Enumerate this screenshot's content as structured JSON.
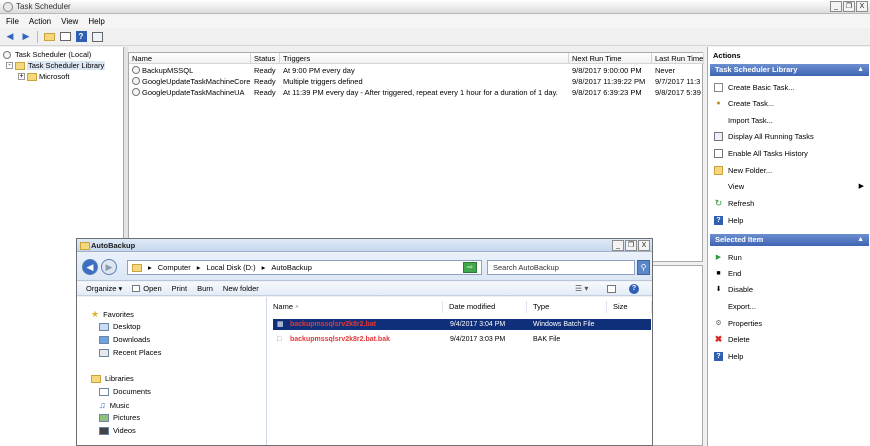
{
  "window": {
    "title": "Task Scheduler",
    "controls": [
      "_",
      "❐",
      "X"
    ]
  },
  "menu": [
    "File",
    "Action",
    "View",
    "Help"
  ],
  "toolbar": [
    "back-icon",
    "forward-icon",
    "folder-up-icon",
    "console-tree-icon",
    "help-icon",
    "properties-icon"
  ],
  "tree": {
    "root": "Task Scheduler (Local)",
    "library": "Task Scheduler Library",
    "child": "Microsoft"
  },
  "tasks": {
    "columns": [
      "Name",
      "Status",
      "Triggers",
      "Next Run Time",
      "Last Run Time"
    ],
    "rows": [
      {
        "name": "BackupMSSQL",
        "status": "Ready",
        "triggers": "At 9:00 PM every day",
        "next": "9/8/2017 9:00:00 PM",
        "last": "Never"
      },
      {
        "name": "GoogleUpdateTaskMachineCore",
        "status": "Ready",
        "triggers": "Multiple triggers defined",
        "next": "9/8/2017 11:39:22 PM",
        "last": "9/7/2017 11:3"
      },
      {
        "name": "GoogleUpdateTaskMachineUA",
        "status": "Ready",
        "triggers": "At 11:39 PM every day - After triggered, repeat every 1 hour for a duration of 1 day.",
        "next": "9/8/2017 6:39:23 PM",
        "last": "9/8/2017 5:39"
      }
    ]
  },
  "actions": {
    "header": "Actions",
    "library_section": "Task Scheduler Library",
    "library_items": [
      "Create Basic Task...",
      "Create Task...",
      "Import Task...",
      "Display All Running Tasks",
      "Enable All Tasks History",
      "New Folder...",
      "View",
      "Refresh",
      "Help"
    ],
    "selected_section": "Selected Item",
    "selected_items": [
      "Run",
      "End",
      "Disable",
      "Export...",
      "Properties",
      "Delete",
      "Help"
    ]
  },
  "explorer": {
    "title": "AutoBackup",
    "controls": [
      "_",
      "❐",
      "X"
    ],
    "breadcrumb": [
      "Computer",
      "Local Disk (D:)",
      "AutoBackup"
    ],
    "search_placeholder": "Search AutoBackup",
    "commands": [
      "Organize ▾",
      "Open",
      "Print",
      "Burn",
      "New folder"
    ],
    "nav": {
      "favorites_header": "Favorites",
      "favorites": [
        "Desktop",
        "Downloads",
        "Recent Places"
      ],
      "libraries_header": "Libraries",
      "libraries": [
        "Documents",
        "Music",
        "Pictures",
        "Videos"
      ]
    },
    "columns": [
      "Name",
      "Date modified",
      "Type",
      "Size"
    ],
    "files": [
      {
        "name": "backupmssqlsrv2k8r2.bat",
        "date": "9/4/2017 3:04 PM",
        "type": "Windows Batch File",
        "size": ""
      },
      {
        "name": "backupmssqlsrv2k8r2.bat.bak",
        "date": "9/4/2017 3:03 PM",
        "type": "BAK File",
        "size": ""
      }
    ]
  }
}
